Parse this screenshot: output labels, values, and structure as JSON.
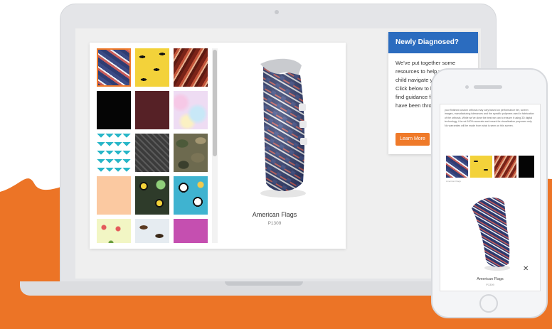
{
  "colors": {
    "accent_orange": "#ec7426",
    "header_blue": "#2b6cbf",
    "learn_button": "#ef7a2a",
    "device_gray": "#e4e5e8"
  },
  "swatches": [
    {
      "name": "American Flags",
      "selected": true
    },
    {
      "name": "Yellow Mustaches"
    },
    {
      "name": "Bacon"
    },
    {
      "name": "Black"
    },
    {
      "name": "Maroon"
    },
    {
      "name": "Pastel Tie Dye"
    },
    {
      "name": "Teal Chevron"
    },
    {
      "name": "Diamond Plate"
    },
    {
      "name": "Camouflage"
    },
    {
      "name": "Peach"
    },
    {
      "name": "Bees"
    },
    {
      "name": "Pandas"
    },
    {
      "name": "Cupcakes"
    },
    {
      "name": "Horses"
    },
    {
      "name": "Magenta"
    }
  ],
  "selected_design": {
    "name": "American Flags",
    "code": "P1309"
  },
  "sidebar": {
    "title": "Newly Diagnosed?",
    "body": "We've put together some resources to help you and your child navigate your journey. Click below to learn more and find guidance from others who have been through this already.",
    "button_label": "Learn More"
  },
  "phone": {
    "disclaimer": "your finished custom orthosis may vary based on performance tier, screen images, manufacturing tolerances and the specific polymers used in fabrication of the orthosis. While we've done the best we can to ensure it using 3D digital technology, it is not 100% accurate and meant for visualization purposes only. No warranties will be made from what is seen on this screen.",
    "selected_caption": "American Flags",
    "design_name": "American Flags",
    "design_code": "P1309",
    "close_glyph": "✕"
  }
}
